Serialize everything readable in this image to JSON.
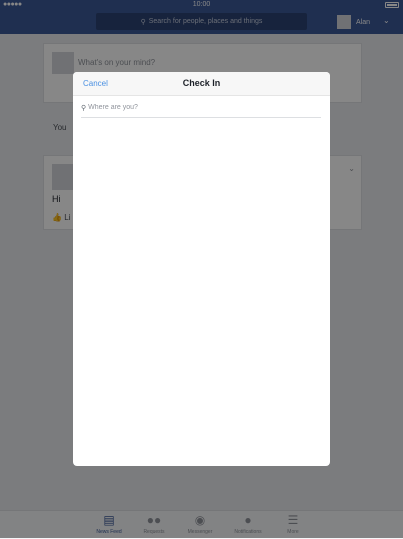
{
  "status_bar": {
    "signal": "●●●●●",
    "time": "10:00"
  },
  "nav": {
    "search_placeholder": "Search for people, places and things",
    "user_name": "Alan",
    "icons": {
      "search": "search-icon",
      "chevron": "chevron-down-icon"
    }
  },
  "feed": {
    "composer_prompt": "What's on your mind?",
    "notice_text": "You",
    "post": {
      "text": "Hi",
      "like_label": "Li"
    }
  },
  "tabs": [
    {
      "label": "News Feed",
      "icon": "news-feed-icon"
    },
    {
      "label": "Requests",
      "icon": "friend-requests-icon"
    },
    {
      "label": "Messenger",
      "icon": "messenger-icon"
    },
    {
      "label": "Notifications",
      "icon": "globe-icon"
    },
    {
      "label": "More",
      "icon": "menu-icon"
    }
  ],
  "modal": {
    "cancel_label": "Cancel",
    "title": "Check In",
    "search_placeholder": "Where are you?",
    "search_value": ""
  },
  "colors": {
    "brand": "#3b5998",
    "link": "#4a90e2",
    "overlay": "rgba(0,0,0,0.47)"
  }
}
